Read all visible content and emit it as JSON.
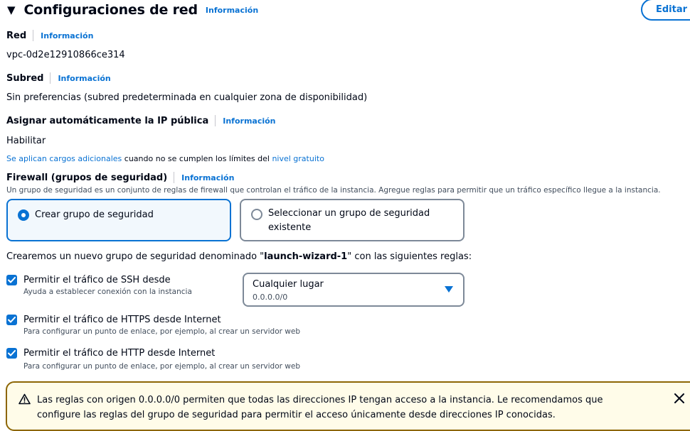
{
  "header": {
    "title": "Configuraciones de red",
    "info": "Información",
    "edit": "Editar"
  },
  "network": {
    "label": "Red",
    "info": "Información",
    "value": "vpc-0d2e12910866ce314"
  },
  "subnet": {
    "label": "Subred",
    "info": "Información",
    "value": "Sin preferencias (subred predeterminada en cualquier zona de disponibilidad)"
  },
  "public_ip": {
    "label": "Asignar automáticamente la IP pública",
    "info": "Información",
    "value": "Habilitar",
    "note_link1": "Se aplican cargos adicionales",
    "note_text": " cuando no se cumplen los límites del ",
    "note_link2": "nivel gratuito"
  },
  "firewall": {
    "label": "Firewall (grupos de seguridad)",
    "info": "Información",
    "description": "Un grupo de seguridad es un conjunto de reglas de firewall que controlan el tráfico de la instancia. Agregue reglas para permitir que un tráfico específico llegue a la instancia.",
    "option_create": "Crear grupo de seguridad",
    "option_select": "Seleccionar un grupo de seguridad existente",
    "create_text_before": "Crearemos un nuevo grupo de seguridad denominado \"",
    "create_name": "launch-wizard-1",
    "create_text_after": "\" con las siguientes reglas:"
  },
  "rules": {
    "ssh": {
      "label": "Permitir el tráfico de SSH desde",
      "desc": "Ayuda a establecer conexión con la instancia"
    },
    "ssh_source": {
      "value": "Cualquier lugar",
      "sub": "0.0.0.0/0"
    },
    "https": {
      "label": "Permitir el tráfico de HTTPS desde Internet",
      "desc": "Para configurar un punto de enlace, por ejemplo, al crear un servidor web"
    },
    "http": {
      "label": "Permitir el tráfico de HTTP desde Internet",
      "desc": "Para configurar un punto de enlace, por ejemplo, al crear un servidor web"
    }
  },
  "alert": {
    "text": "Las reglas con origen 0.0.0.0/0 permiten que todas las direcciones IP tengan acceso a la instancia. Le recomendamos que configure las reglas del grupo de seguridad para permitir el acceso únicamente desde direcciones IP conocidas."
  },
  "colors": {
    "accent": "#0972d3",
    "warning_border": "#8d6605",
    "warning_bg": "#fffce9"
  }
}
